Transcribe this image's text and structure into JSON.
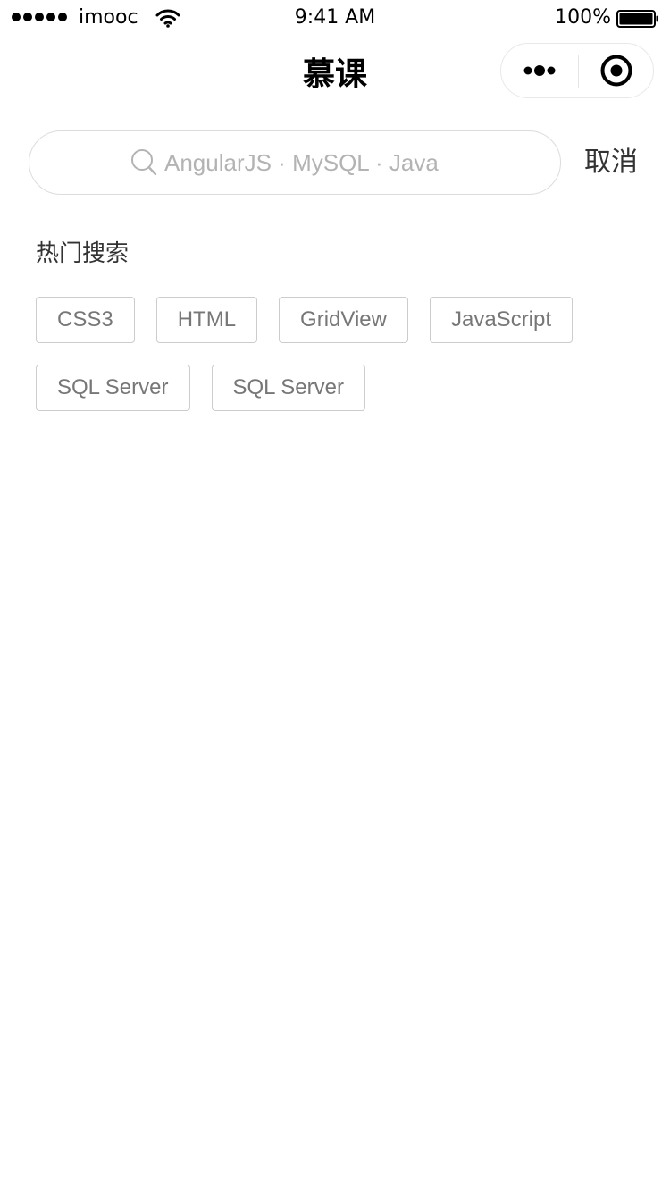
{
  "status_bar": {
    "carrier": "imooc",
    "time": "9:41 AM",
    "battery_percent": "100%",
    "battery_level": 1.0,
    "signal_bars": 5
  },
  "nav": {
    "title": "慕课",
    "menu_icon": "more-dots-icon",
    "close_icon": "target-circle-icon"
  },
  "search": {
    "placeholder": "AngularJS · MySQL · Java",
    "value": "",
    "icon": "search-icon",
    "cancel_label": "取消"
  },
  "hot_search": {
    "title": "热门搜索",
    "tags": [
      "CSS3",
      "HTML",
      "GridView",
      "JavaScript",
      "SQL Server",
      "SQL Server"
    ]
  },
  "colors": {
    "background": "#ffffff",
    "tag_border": "#cccccc",
    "tag_text": "#777777",
    "placeholder": "#b3b3b3"
  }
}
